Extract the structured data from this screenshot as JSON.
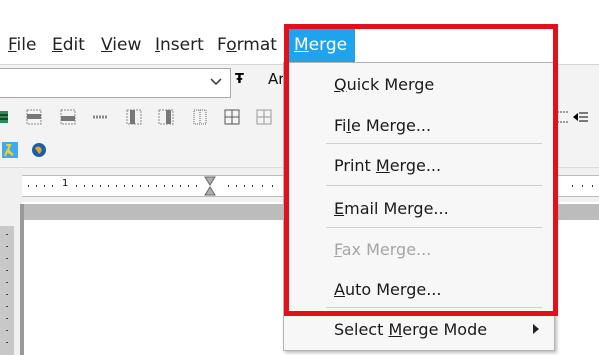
{
  "menubar": {
    "items": [
      {
        "label": "File",
        "underline_index": 0
      },
      {
        "label": "Edit",
        "underline_index": 0
      },
      {
        "label": "View",
        "underline_index": 0
      },
      {
        "label": "Insert",
        "underline_index": 0
      },
      {
        "label": "Format",
        "underline_index": 1
      },
      {
        "label": "Merge",
        "underline_index": 0
      }
    ],
    "active": "Merge"
  },
  "toolbar": {
    "font_name_partial": "Ar"
  },
  "ruler": {
    "mark_label": "1"
  },
  "merge_menu": {
    "items": [
      {
        "label": "Quick Merge",
        "underline_index": 0,
        "enabled": true
      },
      {
        "label": "File Merge...",
        "underline_index": 2,
        "enabled": true
      },
      {
        "label": "Print Merge...",
        "underline_index": 6,
        "enabled": true
      },
      {
        "label": "Email Merge...",
        "underline_index": 0,
        "enabled": true
      },
      {
        "label": "Fax Merge...",
        "underline_index": 0,
        "enabled": false
      },
      {
        "label": "Auto Merge...",
        "underline_index": 0,
        "enabled": true
      },
      {
        "label": "Select Merge Mode",
        "underline_index": 7,
        "enabled": true,
        "has_submenu": true
      }
    ]
  },
  "colors": {
    "highlight": "#1fa3ec",
    "callout": "#e2101a",
    "disabled_text": "#a5a5a5"
  }
}
